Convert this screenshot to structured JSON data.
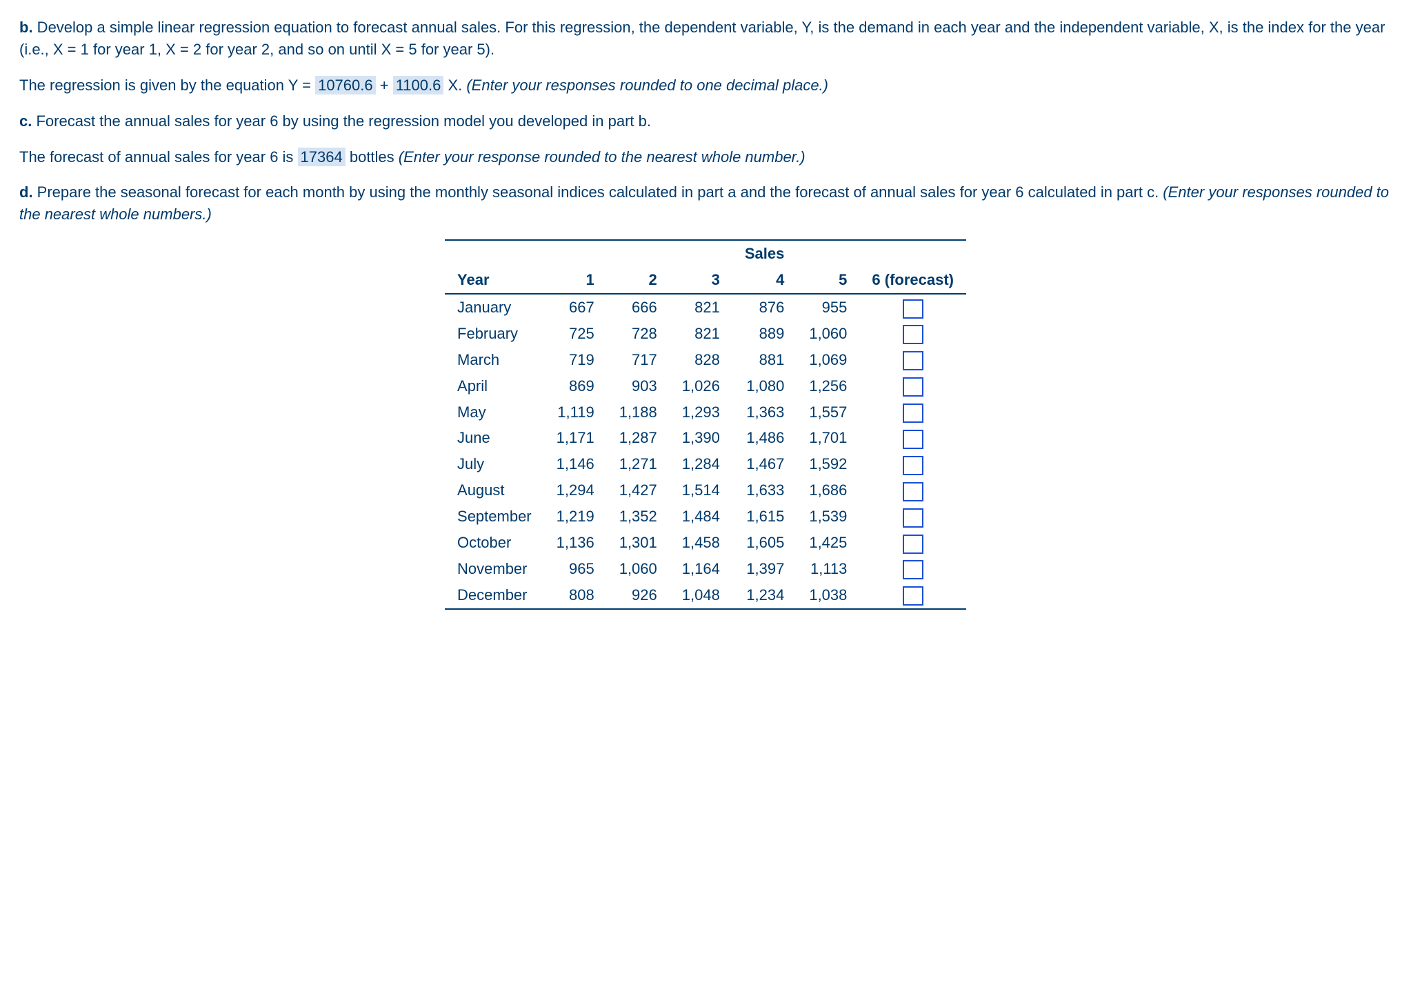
{
  "partB": {
    "label": "b.",
    "text1": " Develop a simple linear regression equation to forecast annual sales. For this regression, the dependent variable, Y, is the demand in each year and the independent variable, X, is the index for the year (i.e., X = 1 for year 1, X = 2 for year 2, and so on until X = 5 for year 5).",
    "eq_lead": "The regression is given by the equation Y = ",
    "intercept": "10760.6",
    "eq_plus": " + ",
    "slope": "1100.6",
    "eq_tail": " X. ",
    "eq_note": "(Enter your responses rounded to one decimal place.)"
  },
  "partC": {
    "label": "c.",
    "text1": " Forecast the annual sales for year 6 by using the regression model you developed in part b.",
    "fc_lead": "The forecast of annual sales for year 6 is ",
    "fc_value": "17364",
    "fc_tail": " bottles ",
    "fc_note": "(Enter your response rounded to the nearest whole number.)"
  },
  "partD": {
    "label": "d.",
    "text1": " Prepare the seasonal forecast for each month by using the monthly seasonal indices calculated in part a and the forecast of annual sales for year 6 calculated in part c. ",
    "note": "(Enter your responses rounded to the nearest whole numbers.)"
  },
  "table": {
    "year_label": "Year",
    "sales_label": "Sales",
    "forecast_label": "6 (forecast)",
    "cols": [
      "1",
      "2",
      "3",
      "4",
      "5"
    ],
    "rows": [
      {
        "m": "January",
        "v": [
          "667",
          "666",
          "821",
          "876",
          "955"
        ]
      },
      {
        "m": "February",
        "v": [
          "725",
          "728",
          "821",
          "889",
          "1,060"
        ]
      },
      {
        "m": "March",
        "v": [
          "719",
          "717",
          "828",
          "881",
          "1,069"
        ]
      },
      {
        "m": "April",
        "v": [
          "869",
          "903",
          "1,026",
          "1,080",
          "1,256"
        ]
      },
      {
        "m": "May",
        "v": [
          "1,119",
          "1,188",
          "1,293",
          "1,363",
          "1,557"
        ]
      },
      {
        "m": "June",
        "v": [
          "1,171",
          "1,287",
          "1,390",
          "1,486",
          "1,701"
        ]
      },
      {
        "m": "July",
        "v": [
          "1,146",
          "1,271",
          "1,284",
          "1,467",
          "1,592"
        ]
      },
      {
        "m": "August",
        "v": [
          "1,294",
          "1,427",
          "1,514",
          "1,633",
          "1,686"
        ]
      },
      {
        "m": "September",
        "v": [
          "1,219",
          "1,352",
          "1,484",
          "1,615",
          "1,539"
        ]
      },
      {
        "m": "October",
        "v": [
          "1,136",
          "1,301",
          "1,458",
          "1,605",
          "1,425"
        ]
      },
      {
        "m": "November",
        "v": [
          "965",
          "1,060",
          "1,164",
          "1,397",
          "1,113"
        ]
      },
      {
        "m": "December",
        "v": [
          "808",
          "926",
          "1,048",
          "1,234",
          "1,038"
        ]
      }
    ]
  }
}
